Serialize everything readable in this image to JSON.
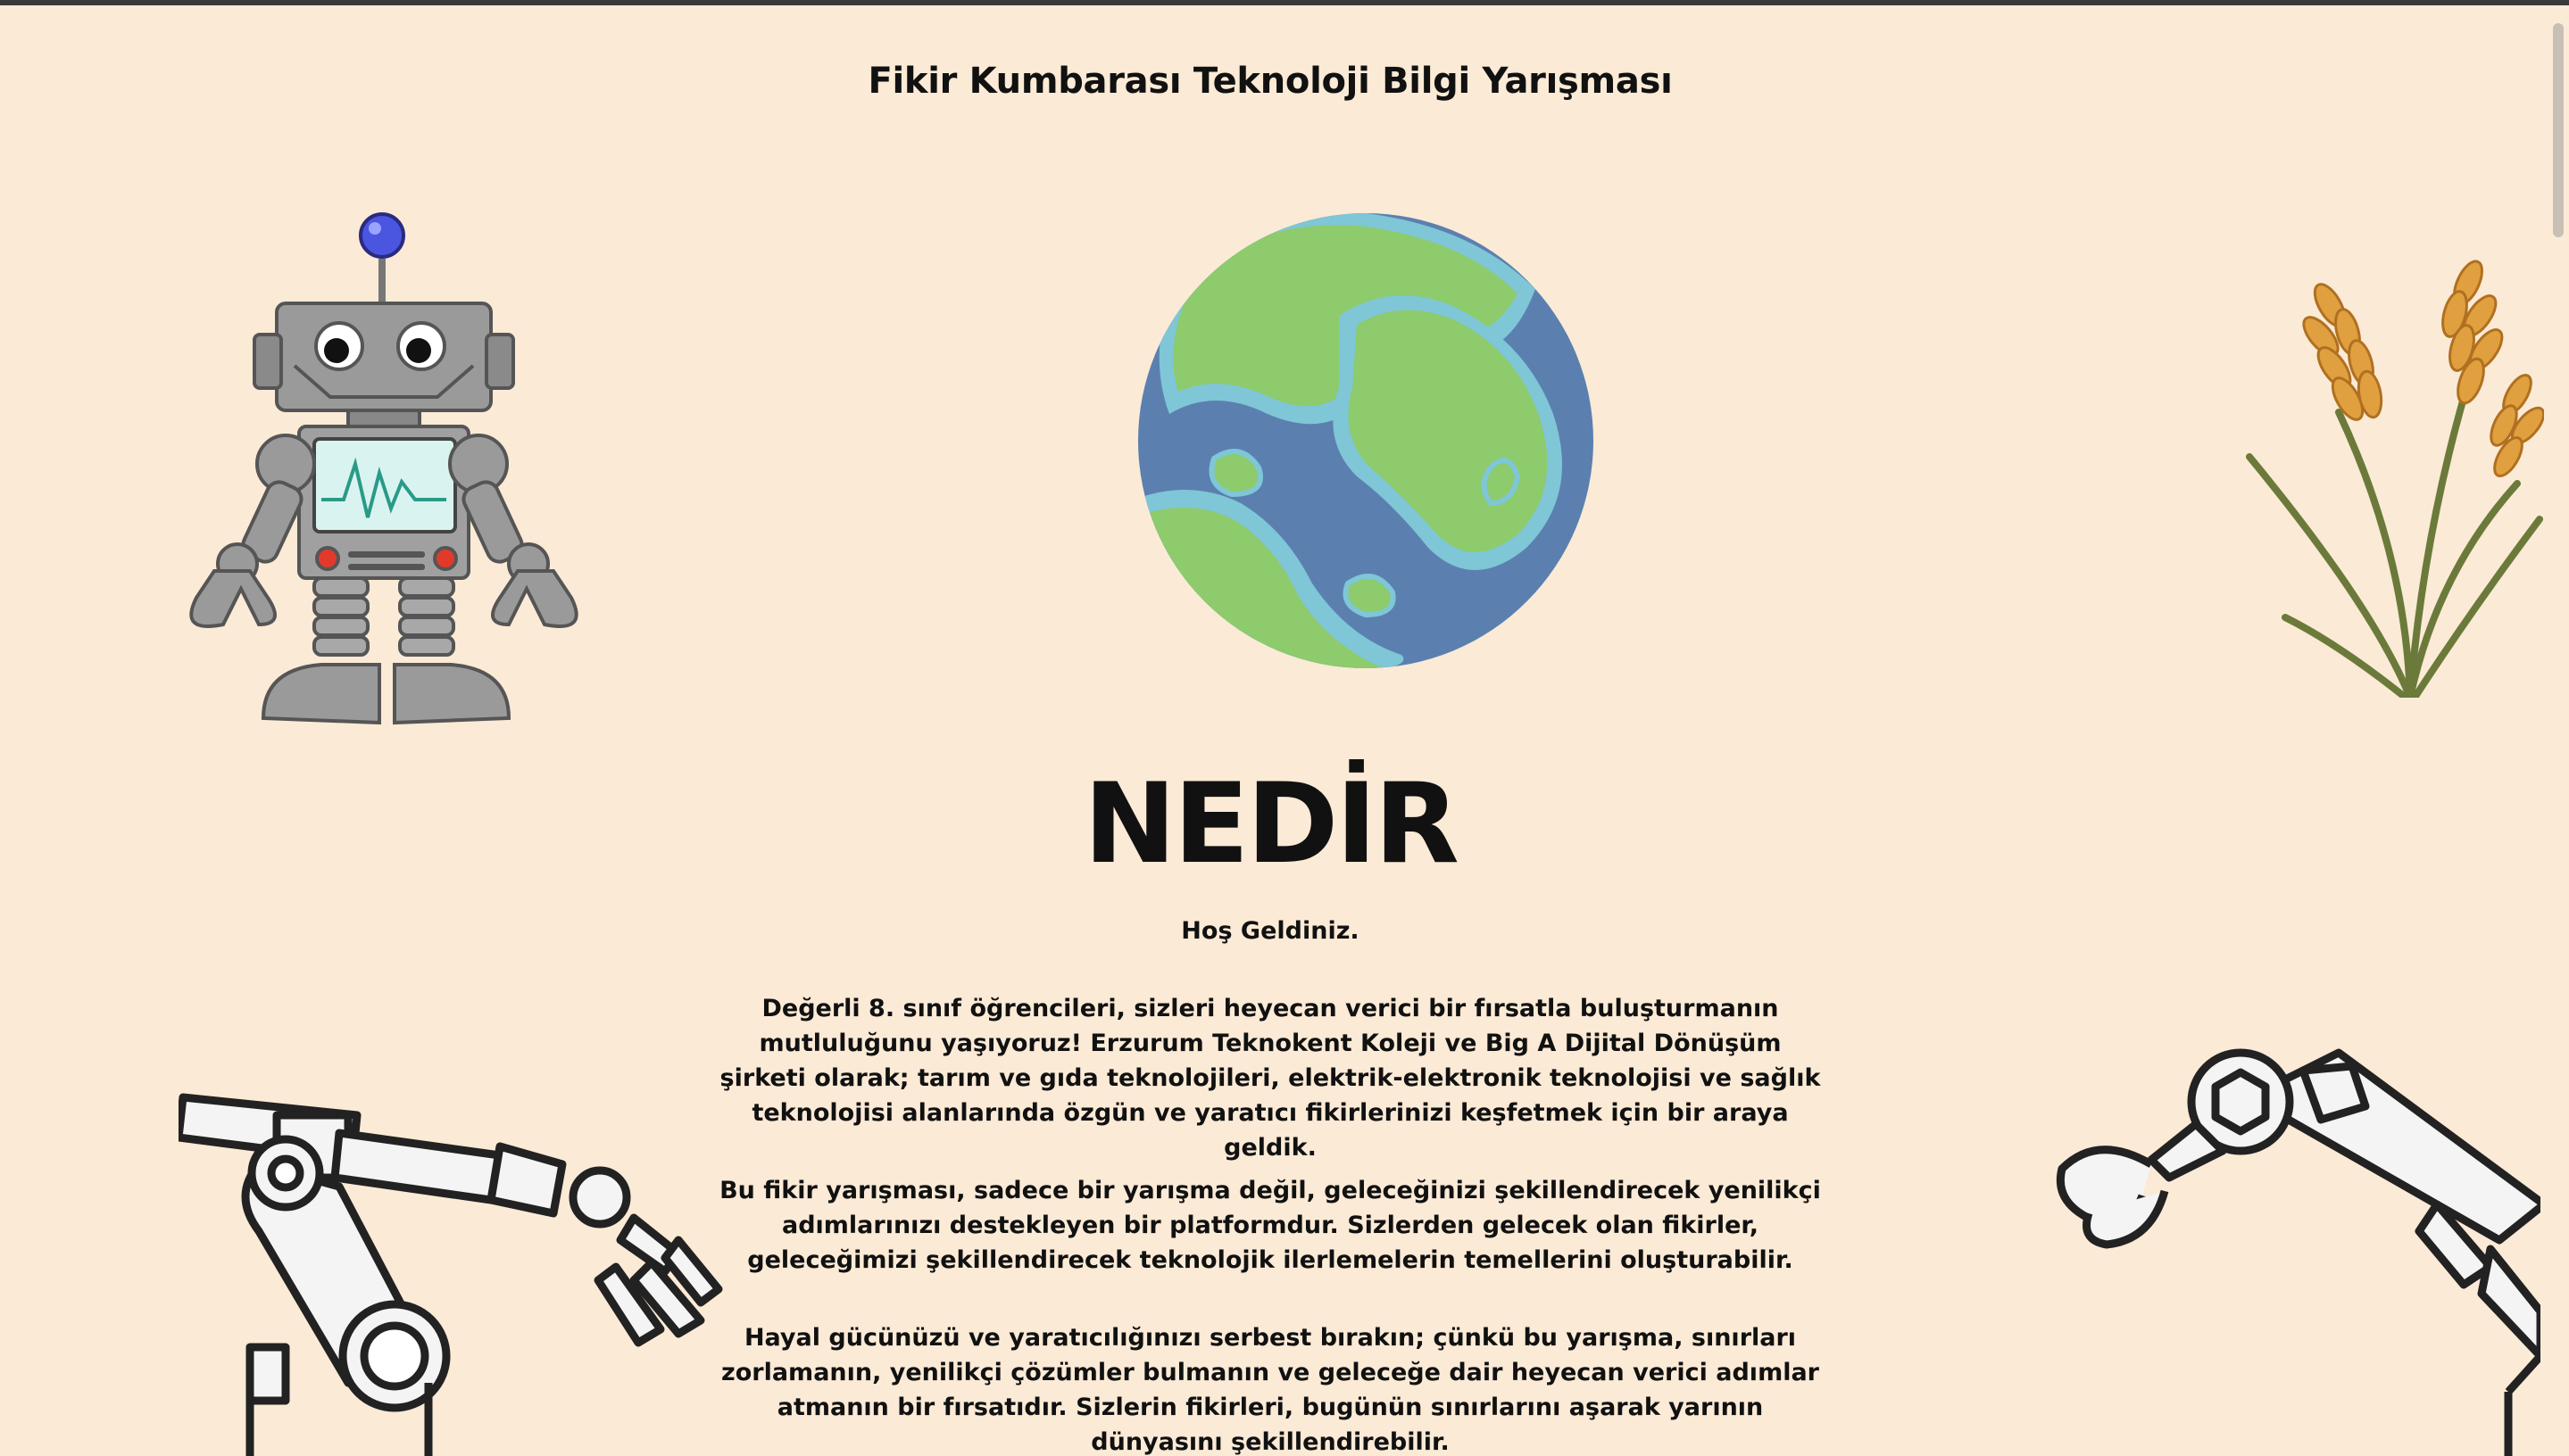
{
  "header": {
    "title": "Fikir Kumbarası Teknoloji Bilgi Yarışması"
  },
  "hero": {
    "heading": "NEDİR",
    "welcome": "Hoş Geldiniz.",
    "paragraphs": [
      "Değerli 8. sınıf öğrencileri, sizleri heyecan verici bir fırsatla buluşturmanın mutluluğunu yaşıyoruz! Erzurum Teknokent Koleji ve Big A Dijital Dönüşüm şirketi olarak; tarım ve gıda teknolojileri, elektrik-elektronik teknolojisi ve sağlık teknolojisi alanlarında özgün ve yaratıcı fikirlerinizi keşfetmek için bir araya geldik.",
      "Bu fikir yarışması, sadece bir yarışma değil, geleceğinizi şekillendirecek yenilikçi adımlarınızı destekleyen bir platformdur. Sizlerden gelecek olan fikirler, geleceğimizi şekillendirecek teknolojik ilerlemelerin temellerini oluşturabilir.",
      "Hayal gücünüzü ve yaratıcılığınızı serbest bırakın; çünkü bu yarışma, sınırları zorlamanın, yenilikçi çözümler bulmanın ve geleceğe dair heyecan verici adımlar atmanın bir fırsatıdır. Sizlerin fikirleri, bugünün sınırlarını aşarak yarının dünyasını şekillendirebilir."
    ]
  },
  "illustrations": {
    "robot": "robot-icon",
    "globe": "globe-icon",
    "wheat": "wheat-icon",
    "robotic_arm_left": "robotic-arm-icon",
    "robotic_arm_right": "robotic-arm-icon"
  },
  "colors": {
    "background": "#fbead6",
    "text": "#111111",
    "ocean": "#5b80b0",
    "land": "#8dcb6c",
    "shore": "#7fc6d6",
    "wheat": "#e0a040"
  }
}
